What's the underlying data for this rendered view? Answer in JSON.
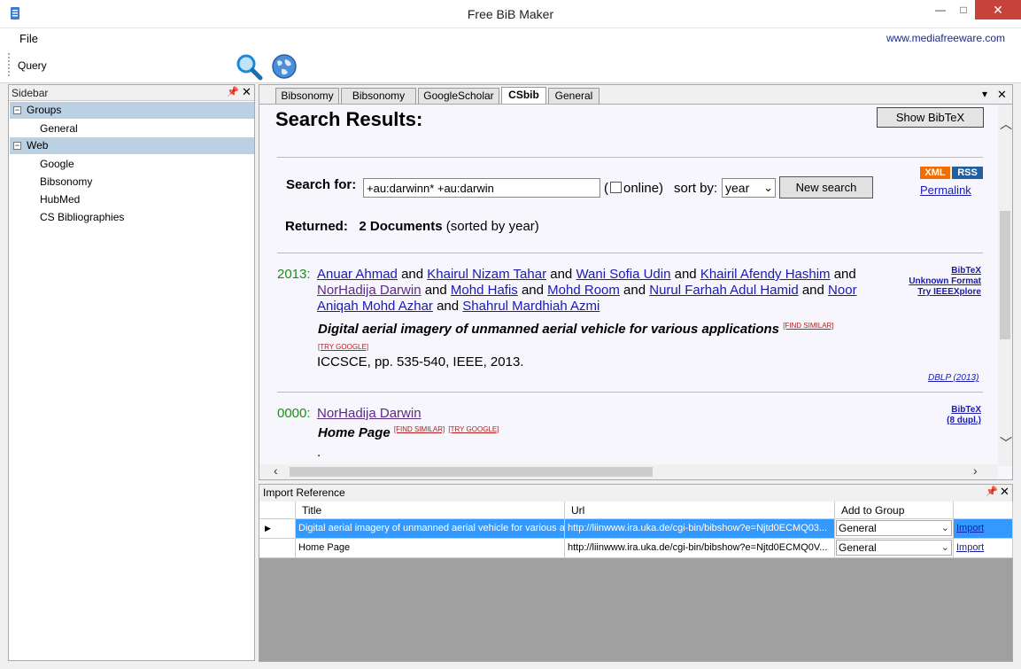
{
  "window": {
    "title": "Free BiB Maker",
    "minimize": "—",
    "maximize": "□",
    "close": "✕"
  },
  "menu": {
    "file": "File",
    "website": "www.mediafreeware.com"
  },
  "toolbar": {
    "query_label": "Query",
    "query_value": ""
  },
  "sidebar": {
    "title": "Sidebar",
    "groups": [
      {
        "label": "Groups",
        "items": [
          "General"
        ]
      },
      {
        "label": "Web",
        "items": [
          "Google",
          "Bibsonomy",
          "HubMed",
          "CS Bibliographies"
        ]
      }
    ]
  },
  "tabs": [
    "Bibsonomy",
    "Bibsonomy",
    "GoogleScholar",
    "CSbib",
    "General"
  ],
  "active_tab": "CSbib",
  "browser": {
    "heading": "Search Results:",
    "show_bibtex": "Show BibTeX",
    "search_for_label": "Search for:",
    "search_for_value": "+au:darwinn* +au:darwin",
    "online_open": "(",
    "online_label": "online)",
    "sort_by_label": "sort by:",
    "sort_by_value": "year",
    "new_search": "New search",
    "xml": "XML",
    "rss": "RSS",
    "permalink": "Permalink",
    "returned_label": "Returned:",
    "returned_count": "2 Documents",
    "returned_note": "(sorted by year)",
    "results": [
      {
        "year": "2013:",
        "authors": [
          "Anuar Ahmad",
          "Khairul Nizam Tahar",
          "Wani Sofia Udin",
          "Khairil Afendy Hashim",
          "NorHadija Darwin",
          "Mohd Hafis",
          "Mohd Room",
          "Nurul Farhah Adul Hamid",
          "Noor Aniqah Mohd Azhar",
          "Shahrul Mardhiah Azmi"
        ],
        "title": "Digital aerial imagery of unmanned aerial vehicle for various applications",
        "find_similar": "[FIND SIMILAR]",
        "try_google": "[TRY GOOGLE]",
        "venue": "ICCSCE, pp. 535-540, IEEE, 2013.",
        "links": [
          "BibTeX",
          "Unknown Format",
          "Try IEEEXplore"
        ],
        "source": "DBLP (2013)"
      },
      {
        "year": "0000:",
        "authors": [
          "NorHadija Darwin"
        ],
        "title": "Home Page",
        "find_similar": "[FIND SIMILAR]",
        "try_google": "[TRY GOOGLE]",
        "venue": ".",
        "links": [
          "BibTeX",
          "(8 dupl.)"
        ]
      }
    ],
    "and": "and"
  },
  "import_panel": {
    "title": "Import Reference",
    "columns": [
      "Title",
      "Url",
      "Add to Group"
    ],
    "rows": [
      {
        "title": "Digital aerial imagery of unmanned aerial vehicle for various a...",
        "url": "http://liinwww.ira.uka.de/cgi-bin/bibshow?e=Njtd0ECMQ03...",
        "group": "General",
        "action": "Import",
        "selected": true
      },
      {
        "title": "Home Page",
        "url": "http://liinwww.ira.uka.de/cgi-bin/bibshow?e=Njtd0ECMQ0V...",
        "group": "General",
        "action": "Import",
        "selected": false
      }
    ]
  },
  "colors": {
    "selection": "#3399ff",
    "tree_group": "#bcd0e4",
    "link": "#1a1ab0",
    "year": "#1f8a1f",
    "close_button": "#c7423a"
  },
  "icons": {
    "search": "search-icon",
    "web": "globe-icon",
    "app": "app-icon"
  }
}
